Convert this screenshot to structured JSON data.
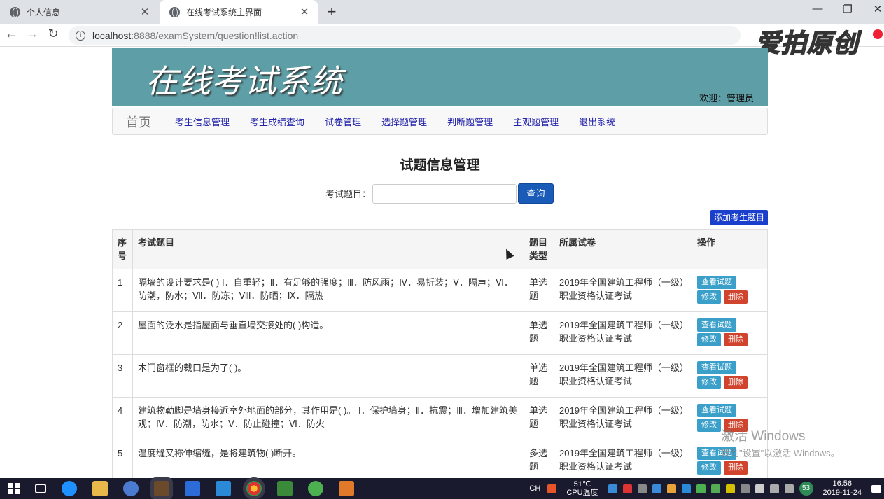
{
  "browser": {
    "tabs": [
      {
        "label": "个人信息",
        "active": false
      },
      {
        "label": "在线考试系统主界面",
        "active": true
      }
    ],
    "url_host": "localhost",
    "url_path": ":8888/examSystem/question!list.action",
    "watermark": "爱拍原创"
  },
  "banner": {
    "title": "在线考试系统",
    "welcome": "欢迎：管理员"
  },
  "nav": {
    "brand": "首页",
    "items": [
      "考生信息管理",
      "考生成绩查询",
      "试卷管理",
      "选择题管理",
      "判断题管理",
      "主观题管理",
      "退出系统"
    ]
  },
  "page": {
    "title": "试题信息管理",
    "search_label": "考试题目：",
    "search_value": "",
    "search_button": "查询",
    "add_button": "添加考生题目"
  },
  "table": {
    "headers": [
      "序号",
      "考试题目",
      "题目类型",
      "所属试卷",
      "操作"
    ],
    "rows": [
      {
        "seq": "1",
        "question": "隔墙的设计要求是(    ) Ⅰ．自重轻；Ⅱ．有足够的强度；Ⅲ．防风雨；Ⅳ．易折装；Ⅴ．隔声；Ⅵ．防潮，防水；Ⅶ．防冻；Ⅷ．防晒；Ⅸ．隔热",
        "type": "单选题",
        "paper": "2019年全国建筑工程师（一级）职业资格认证考试"
      },
      {
        "seq": "2",
        "question": "屋面的泛水是指屋面与垂直墙交接处的(      )构造。",
        "type": "单选题",
        "paper": "2019年全国建筑工程师（一级）职业资格认证考试"
      },
      {
        "seq": "3",
        "question": "木门窗框的裁口是为了(      )。",
        "type": "单选题",
        "paper": "2019年全国建筑工程师（一级）职业资格认证考试"
      },
      {
        "seq": "4",
        "question": "建筑物勒脚是墙身接近室外地面的部分，其作用是(    )。    Ⅰ．保护墙身；Ⅱ．抗震；Ⅲ．增加建筑美观；Ⅳ．防潮，防水；Ⅴ．防止碰撞；Ⅵ．防火",
        "type": "单选题",
        "paper": "2019年全国建筑工程师（一级）职业资格认证考试"
      },
      {
        "seq": "5",
        "question": "温度缝又称伸缩缝，是将建筑物(      )断开。",
        "type": "多选题",
        "paper": "2019年全国建筑工程师（一级）职业资格认证考试"
      }
    ],
    "ops": {
      "view": "查看试题",
      "edit": "修改",
      "delete": "删除"
    }
  },
  "activation": {
    "line1": "激活 Windows",
    "line2": "转到\"设置\"以激活 Windows。"
  },
  "taskbar": {
    "temp": "51℃",
    "temp_label": "CPU温度",
    "ime": "CH",
    "time": "16:56",
    "date": "2019-11-24",
    "badge": "53"
  }
}
